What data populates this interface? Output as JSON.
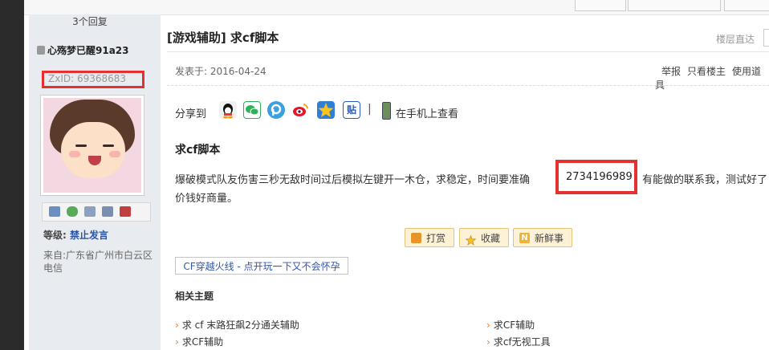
{
  "thread": {
    "reply_count": "3个回复",
    "title": "[游戏辅助] 求cf脚本",
    "floor_jump": "楼层直达"
  },
  "user": {
    "name": "心殇梦已醒91a23",
    "zxid": "ZxID: 69368683",
    "level_label": "等级:",
    "level_value": "禁止发言",
    "origin": "来自:广东省广州市白云区电信"
  },
  "post": {
    "date": "发表于: 2016-04-24",
    "actions": [
      "举报",
      "只看楼主",
      "使用道具"
    ],
    "share_label": "分享到",
    "share_icons": [
      "qq-icon",
      "wechat-icon",
      "pengyou-icon",
      "weibo-icon",
      "qzone-icon",
      "tieba-icon"
    ],
    "share_divider": "|",
    "mobile_view": "在手机上查看",
    "content_title": "求cf脚本",
    "content_line1": "爆破模式队友伤害三秒无敌时间过后模拟左键开一木仓，求稳定，时间要准确",
    "qq_number": "2734196989",
    "content_tail": "有能做的联系我，测试好了",
    "content_line2": "价钱好商量。",
    "buttons": {
      "reward": "打赏",
      "favorite": "收藏",
      "news": "新鲜事"
    },
    "promo_link": "CF穿越火线 - 点开玩一下又不会怀孕"
  },
  "related": {
    "title": "相关主题",
    "items": [
      "求 cf 末路狂飙2分通关辅助",
      "求CF辅助",
      "求CF辅助",
      "求cf无视工具"
    ]
  },
  "colors": {
    "highlight_box": "#e53030",
    "link_blue": "#2a55a5",
    "sidebar_bg": "#e8ebf0",
    "button_bg": "#fdf1d6"
  }
}
